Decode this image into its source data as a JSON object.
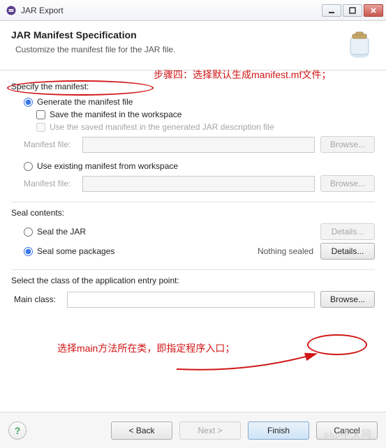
{
  "window": {
    "title": "JAR Export"
  },
  "header": {
    "title": "JAR Manifest Specification",
    "subtitle": "Customize the manifest file for the JAR file."
  },
  "manifest": {
    "section_label": "Specify the manifest:",
    "generate_label": "Generate the manifest file",
    "save_in_workspace_label": "Save the manifest in the workspace",
    "use_saved_in_desc_label": "Use the saved manifest in the generated JAR description file",
    "manifest_file_label": "Manifest file:",
    "manifest_file_value": "",
    "browse_label": "Browse...",
    "use_existing_label": "Use existing manifest from workspace",
    "manifest_file_label2": "Manifest file:",
    "manifest_file_value2": "",
    "browse_label2": "Browse..."
  },
  "seal": {
    "section_label": "Seal contents:",
    "seal_jar_label": "Seal the JAR",
    "details_label1": "Details...",
    "seal_some_label": "Seal some packages",
    "nothing_sealed": "Nothing sealed",
    "details_label2": "Details..."
  },
  "entry": {
    "section_label": "Select the class of the application entry point:",
    "main_class_label": "Main class:",
    "main_class_value": "",
    "browse_label": "Browse..."
  },
  "footer": {
    "back": "< Back",
    "next": "Next >",
    "finish": "Finish",
    "cancel": "Cancel"
  },
  "annotations": {
    "step4": "步骤四：选择默认生成manifest.mf文件；",
    "mainclass_note": "选择main方法所在类，即指定程序入口；"
  },
  "watermark": "php中文网"
}
